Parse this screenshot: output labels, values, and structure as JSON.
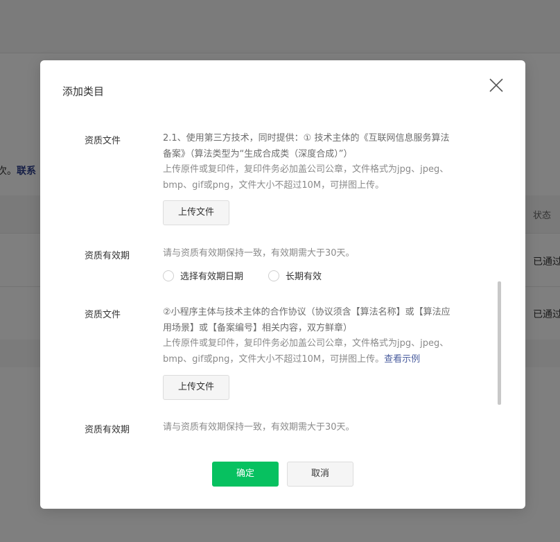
{
  "background": {
    "notice_prefix": "次。",
    "notice_link": "联系",
    "status_header": "状态",
    "rows": [
      {
        "status": "已通过"
      },
      {
        "status": "已通过"
      }
    ]
  },
  "dialog": {
    "title": "添加类目",
    "close_icon": "close-icon",
    "sections": [
      {
        "label": "资质文件",
        "lines": [
          "2.1、使用第三方技术，同时提供：① 技术主体的《互联网信息服务算法",
          "备案》（算法类型为“生成合成类（深度合成）”）",
          "上传原件或复印件，复印件务必加盖公司公章，文件格式为jpg、jpeg、",
          "bmp、gif或png，文件大小不超过10M，可拼图上传。"
        ],
        "upload_label": "上传文件"
      },
      {
        "label": "资质有效期",
        "hint": "请与资质有效期保持一致，有效期需大于30天。",
        "radio_options": [
          "选择有效期日期",
          "长期有效"
        ]
      },
      {
        "label": "资质文件",
        "lines": [
          "②小程序主体与技术主体的合作协议（协议须含【算法名称】或【算法应",
          "用场景】或【备案编号】相关内容，双方鲜章）",
          "上传原件或复印件，复印件务必加盖公司公章，文件格式为jpg、jpeg、",
          "bmp、gif或png，文件大小不超过10M，可拼图上传。"
        ],
        "example_link": "查看示例",
        "upload_label": "上传文件"
      },
      {
        "label": "资质有效期",
        "hint": "请与资质有效期保持一致，有效期需大于30天。"
      }
    ],
    "confirm_label": "确定",
    "cancel_label": "取消"
  },
  "colors": {
    "primary": "#07c160",
    "link": "#4a5d9e",
    "overlay": "rgba(0,0,0,0.5)"
  }
}
